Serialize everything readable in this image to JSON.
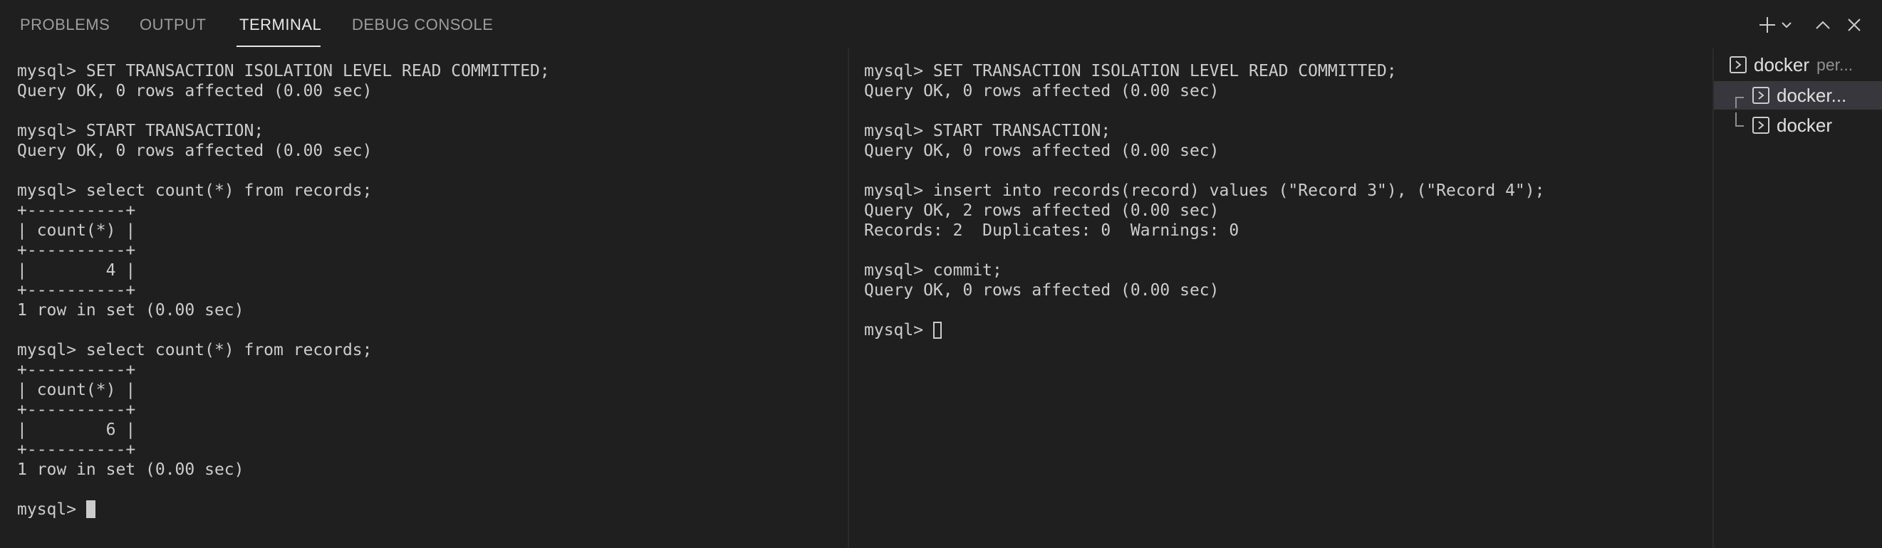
{
  "tabs": [
    "PROBLEMS",
    "OUTPUT",
    "TERMINAL",
    "DEBUG CONSOLE"
  ],
  "active_tab": "TERMINAL",
  "actions": {
    "new_terminal_icon": "plus-icon",
    "dropdown_icon": "chevron-down-icon",
    "maximize_icon": "chevron-up-icon",
    "close_icon": "close-icon"
  },
  "terminal_left": {
    "text": "mysql> SET TRANSACTION ISOLATION LEVEL READ COMMITTED;\nQuery OK, 0 rows affected (0.00 sec)\n\nmysql> START TRANSACTION;\nQuery OK, 0 rows affected (0.00 sec)\n\nmysql> select count(*) from records;\n+----------+\n| count(*) |\n+----------+\n|        4 |\n+----------+\n1 row in set (0.00 sec)\n\nmysql> select count(*) from records;\n+----------+\n| count(*) |\n+----------+\n|        6 |\n+----------+\n1 row in set (0.00 sec)\n\n",
    "prompt": "mysql> "
  },
  "terminal_right": {
    "text": "mysql> SET TRANSACTION ISOLATION LEVEL READ COMMITTED;\nQuery OK, 0 rows affected (0.00 sec)\n\nmysql> START TRANSACTION;\nQuery OK, 0 rows affected (0.00 sec)\n\nmysql> insert into records(record) values (\"Record 3\"), (\"Record 4\");\nQuery OK, 2 rows affected (0.00 sec)\nRecords: 2  Duplicates: 0  Warnings: 0\n\nmysql> commit;\nQuery OK, 0 rows affected (0.00 sec)\n\n",
    "prompt": "mysql> "
  },
  "terminal_list": [
    {
      "name": "docker",
      "description": "per..."
    },
    {
      "name": "docker...",
      "description": ""
    },
    {
      "name": "docker",
      "description": ""
    }
  ],
  "colors": {
    "background": "#1f1f1f",
    "text": "#cccccc",
    "active_tab": "#e7e7e7",
    "inactive_tab": "#9d9d9d",
    "selected_row": "#37373d"
  }
}
